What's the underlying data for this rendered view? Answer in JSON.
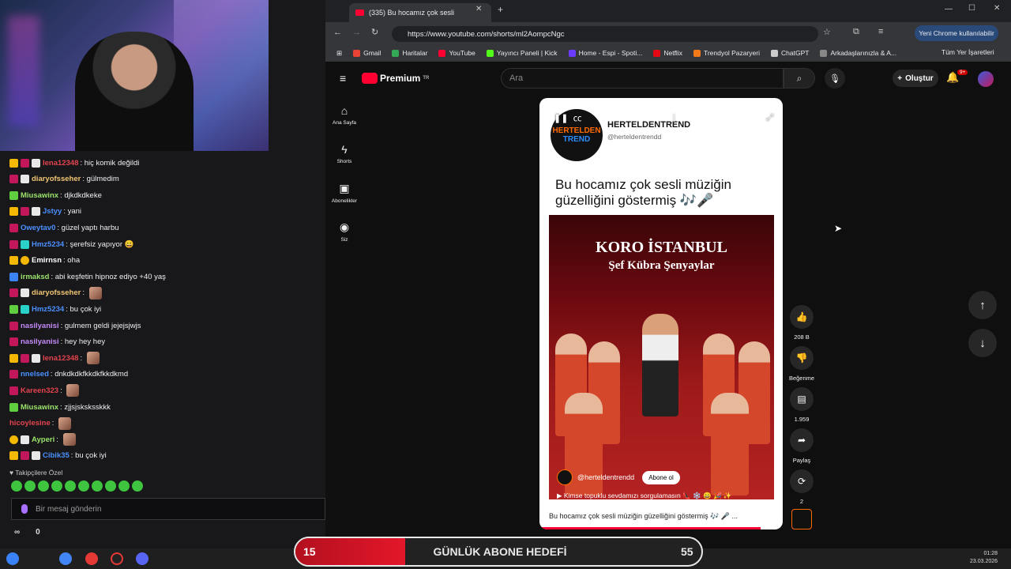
{
  "stream": {
    "chat": [
      {
        "badges": [
          "crown",
          "red",
          "gift"
        ],
        "user": "lena12348",
        "color": "#e4434e",
        "text": "hiç komik değildi"
      },
      {
        "badges": [
          "red",
          "gift"
        ],
        "user": "diaryofsseher",
        "color": "#f0c674",
        "text": "gülmedim"
      },
      {
        "badges": [
          "green"
        ],
        "user": "Miusawinx",
        "color": "#9be36b",
        "text": "djkdkdkeke"
      },
      {
        "badges": [
          "crown",
          "red",
          "gift"
        ],
        "user": "Jstyy",
        "color": "#4a90ff",
        "text": "yani"
      },
      {
        "badges": [
          "red"
        ],
        "user": "Oweytav0",
        "color": "#4a90ff",
        "text": "güzel yaptı harbu"
      },
      {
        "badges": [
          "red",
          "teal"
        ],
        "user": "Hmz5234",
        "color": "#4a90ff",
        "text": "şerefsiz yapıyor 😄"
      },
      {
        "badges": [
          "crown",
          "yellow"
        ],
        "user": "Emirnsn",
        "color": "#ffffff",
        "text": "oha"
      },
      {
        "badges": [
          "blue"
        ],
        "user": "irmaksd",
        "color": "#9be36b",
        "text": "abi keşfetin hipnoz ediyo +40 yaş"
      },
      {
        "badges": [
          "red",
          "gift"
        ],
        "user": "diaryofsseher",
        "color": "#f0c674",
        "text": ""
      },
      {
        "badges": [
          "green",
          "teal"
        ],
        "user": "Hmz5234",
        "color": "#4a90ff",
        "text": "bu çok iyi"
      },
      {
        "badges": [
          "red"
        ],
        "user": "nasilyanisi",
        "color": "#c58af9",
        "text": "gulmem geldi jejejsjwjs"
      },
      {
        "badges": [
          "red"
        ],
        "user": "nasilyanisi",
        "color": "#c58af9",
        "text": "hey hey hey"
      },
      {
        "badges": [
          "crown",
          "red",
          "gift"
        ],
        "user": "lena12348",
        "color": "#e4434e",
        "text": ""
      },
      {
        "badges": [
          "red"
        ],
        "user": "nnelsed",
        "color": "#4a90ff",
        "text": "dnkdkdkfkkdkfkkdkmd"
      },
      {
        "badges": [
          "red"
        ],
        "user": "Kareen323",
        "color": "#e4434e",
        "text": ""
      },
      {
        "badges": [
          "green"
        ],
        "user": "Miusawinx",
        "color": "#9be36b",
        "text": "zjjsjsksksskkk"
      },
      {
        "badges": [],
        "user": "hicoylesine",
        "color": "#e4434e",
        "text": ""
      },
      {
        "badges": [
          "yellow",
          "gift"
        ],
        "user": "Ayperi",
        "color": "#9be36b",
        "text": ""
      },
      {
        "badges": [
          "crown",
          "red",
          "gift"
        ],
        "user": "Cibik35",
        "color": "#4a90ff",
        "text": "bu çok iyi"
      }
    ],
    "followers_label": "♥ Takipçilere Özel",
    "message_placeholder": "Bir mesaj gönderin",
    "stat_left": "∞",
    "stat_right": "0"
  },
  "browser": {
    "tab_title": "(335) Bu hocamız çok sesli",
    "url": "https://www.youtube.com/shorts/ml2AompcNgc",
    "chrome_btn": "Yeni Chrome kullanılabilir",
    "bookmarks": [
      {
        "label": "Gmail",
        "color": "#ea4335"
      },
      {
        "label": "Haritalar",
        "color": "#34a853"
      },
      {
        "label": "YouTube",
        "color": "#ff0033"
      },
      {
        "label": "Yayıncı Paneli | Kick",
        "color": "#53fc18"
      },
      {
        "label": "Home - Espi - Spoti...",
        "color": "#6b3cff"
      },
      {
        "label": "Netflix",
        "color": "#e50914"
      },
      {
        "label": "Trendyol Pazaryeri",
        "color": "#f27a1a"
      },
      {
        "label": "ChatGPT",
        "color": "#cccccc"
      },
      {
        "label": "Arkadaşlarınızla & A...",
        "color": "#888888"
      }
    ],
    "all_bookmarks": "Tüm Yer İşaretleri"
  },
  "youtube": {
    "logo": "Premium",
    "logo_sup": "TR",
    "search_placeholder": "Ara",
    "create": "Oluştur",
    "notif": "9+",
    "nav": [
      {
        "icon": "⌂",
        "label": "Ana Sayfa"
      },
      {
        "icon": "ϟ",
        "label": "Shorts"
      },
      {
        "icon": "▣",
        "label": "Abonelikler"
      },
      {
        "icon": "◉",
        "label": "Siz"
      }
    ],
    "short": {
      "channel_name": "HERTELDENTREND",
      "channel_handle": "@herteldentrendd",
      "logo_line1": "HERTELDEN",
      "logo_line2": "TREND",
      "title": "Bu hocamız çok sesli müziğin güzelliğini göstermiş 🎶🎤",
      "video_title1": "KORO İSTANBUL",
      "video_title2": "Şef Kübra Şenyaylar",
      "video_channel": "@herteldentrendd",
      "subscribe": "Abone ol",
      "video_desc": "▶ Kimse topuklu sevdamızı sorgulamasın 👠 ❄️ 😄 🎉 ✨",
      "footer": "Bu hocamız çok sesli müziğin güzelliğini göstermiş 🎶 🎤 ..."
    },
    "actions": {
      "likes": "208 B",
      "dislike": "Beğenme",
      "comments": "1.959",
      "share": "Paylaş",
      "remix": "2"
    }
  },
  "overlay": {
    "goal_current": "15",
    "goal_title": "GÜNLÜK ABONE HEDEFİ",
    "goal_target": "55",
    "goal_progress": 0.27
  },
  "taskbar": {
    "time": "01:28",
    "date": "23.03.2026"
  }
}
